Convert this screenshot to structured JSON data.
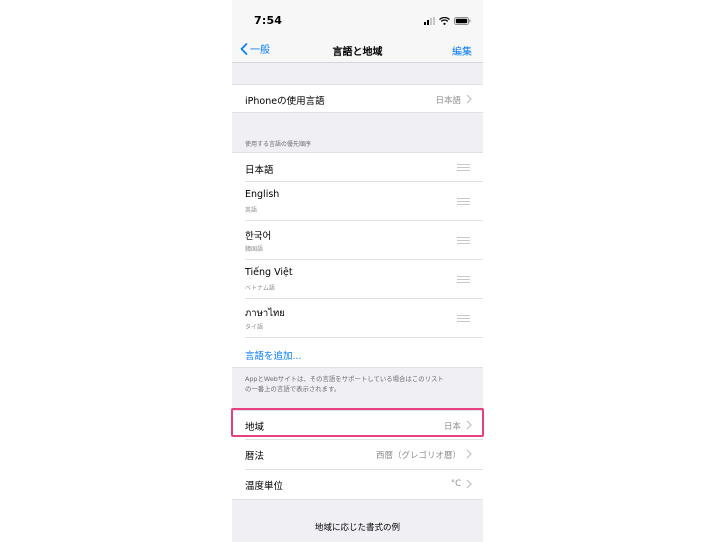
{
  "status": {
    "time": "7:54"
  },
  "nav": {
    "back_label": "一般",
    "title": "言語と地域",
    "edit_label": "編集"
  },
  "iphone_language": {
    "label": "iPhoneの使用言語",
    "value": "日本語"
  },
  "preferred": {
    "header": "使用する言語の優先順序",
    "languages": [
      {
        "name": "日本語",
        "sub": ""
      },
      {
        "name": "English",
        "sub": "英語"
      },
      {
        "name": "한국어",
        "sub": "韓国語"
      },
      {
        "name": "Tiếng Việt",
        "sub": "ベトナム語"
      },
      {
        "name": "ภาษาไทย",
        "sub": "タイ語"
      }
    ],
    "add_label": "言語を追加...",
    "footer_line1": "AppとWebサイトは、その言語をサポートしている場合はこのリスト",
    "footer_line2": "の一番上の言語で表示されます。"
  },
  "region": {
    "label": "地域",
    "value": "日本"
  },
  "calendar": {
    "label": "暦法",
    "value": "西暦（グレゴリオ暦）"
  },
  "temperature": {
    "label": "温度単位",
    "value": "°C"
  },
  "example": {
    "title": "地域に応じた書式の例"
  },
  "colors": {
    "accent": "#007aff",
    "highlight": "#e5407f",
    "background": "#efeff4"
  }
}
